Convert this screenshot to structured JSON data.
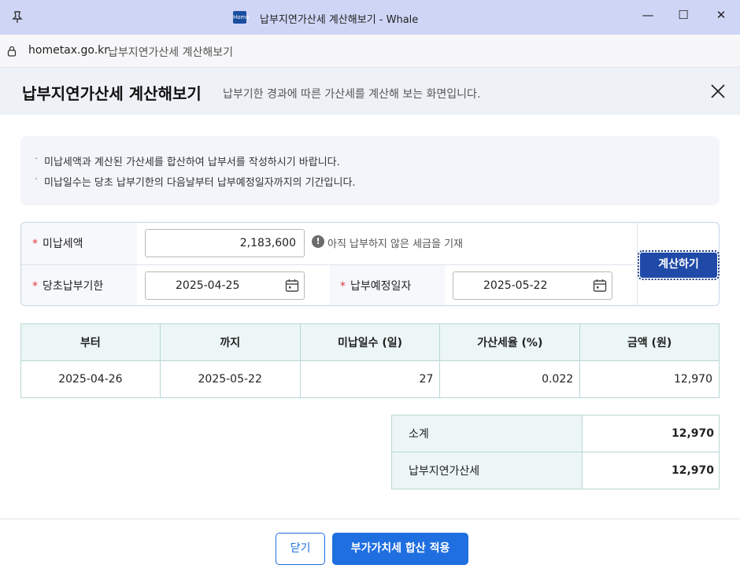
{
  "window": {
    "title": "납부지연가산세 계산해보기 - Whale",
    "app_icon_text": "Home",
    "minimize_glyph": "—",
    "maximize_glyph": "☐",
    "close_glyph": "✕"
  },
  "address_bar": {
    "host": "hometax.go.kr",
    "page_title": "납부지연가산세 계산해보기"
  },
  "header": {
    "title": "납부지연가산세 계산해보기",
    "subtitle": "납부기한 경과에 따른 가산세를 계산해 보는 화면입니다."
  },
  "notice": [
    "미납세액과 계산된 가산세를 합산하여 납부서를 작성하시기 바랍니다.",
    "미납일수는 당초 납부기한의 다음날부터 납부예정일자까지의 기간입니다."
  ],
  "form": {
    "required_mark": "*",
    "unpaid_tax_label": "미납세액",
    "unpaid_tax_value": "2,183,600",
    "unpaid_tax_help": "아직 납부하지 않은 세금을 기재",
    "original_due_label": "당초납부기한",
    "original_due_value": "2025-04-25",
    "planned_payment_label": "납부예정일자",
    "planned_payment_value": "2025-05-22",
    "calculate_button": "계산하기"
  },
  "result_table": {
    "headers": [
      "부터",
      "까지",
      "미납일수 (일)",
      "가산세율 (%)",
      "금액 (원)"
    ],
    "rows": [
      [
        "2025-04-26",
        "2025-05-22",
        "27",
        "0.022",
        "12,970"
      ]
    ]
  },
  "summary": {
    "subtotal_label": "소계",
    "subtotal_value": "12,970",
    "penalty_label": "납부지연가산세",
    "penalty_value": "12,970"
  },
  "footer": {
    "close_button": "닫기",
    "apply_button": "부가가치세 합산 적용"
  },
  "colors": {
    "primary": "#1f6fe0",
    "calc_button": "#1f4aa8",
    "required": "#e23a3a",
    "table_header_bg": "#ebf6f5"
  }
}
